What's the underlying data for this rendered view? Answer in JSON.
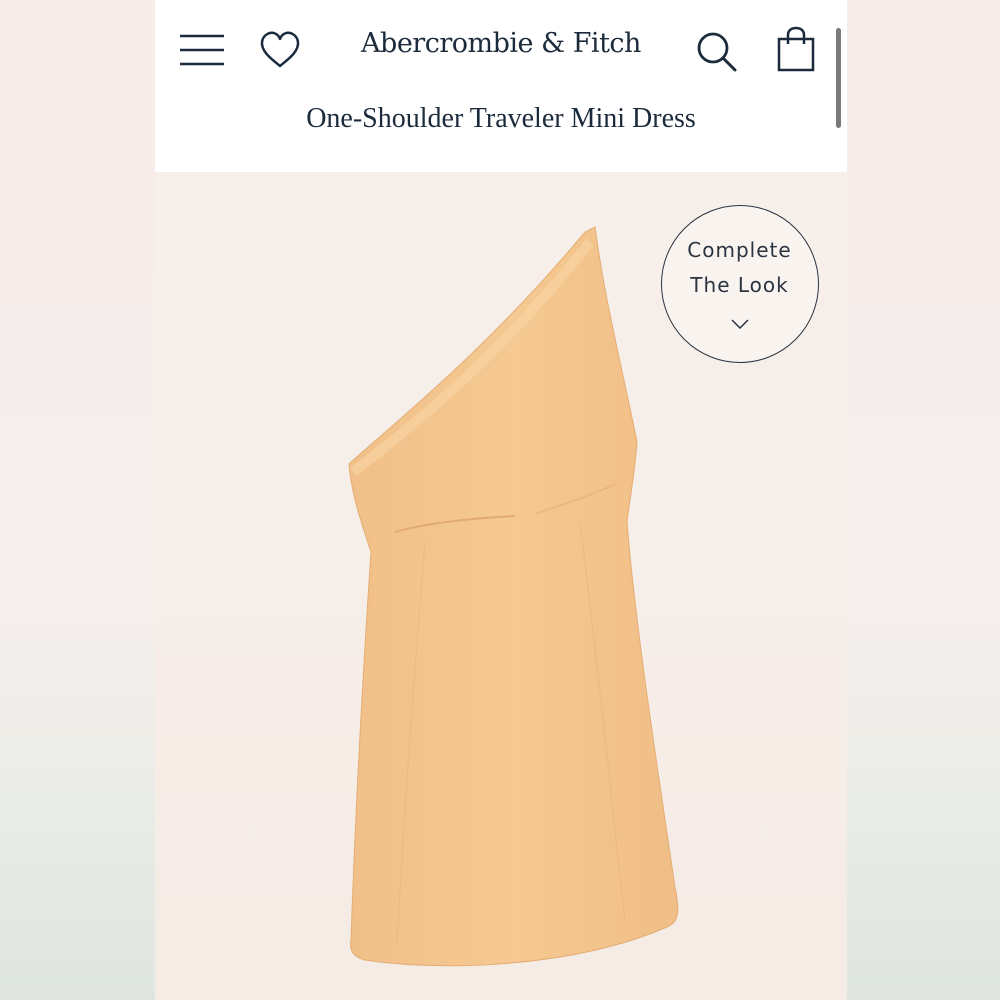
{
  "header": {
    "brand": "Abercrombie & Fitch",
    "product_title": "One-Shoulder Traveler Mini Dress",
    "icons": [
      "menu-icon",
      "heart-icon",
      "search-icon",
      "bag-icon"
    ]
  },
  "overlay": {
    "complete_look_line1": "Complete",
    "complete_look_line2": "The Look",
    "icon": "chevron-down-icon"
  },
  "product_image": {
    "subject": "dress",
    "color": "#f3c58e"
  },
  "colors": {
    "text": "#1c2b3b",
    "background": "#f6ede7"
  }
}
